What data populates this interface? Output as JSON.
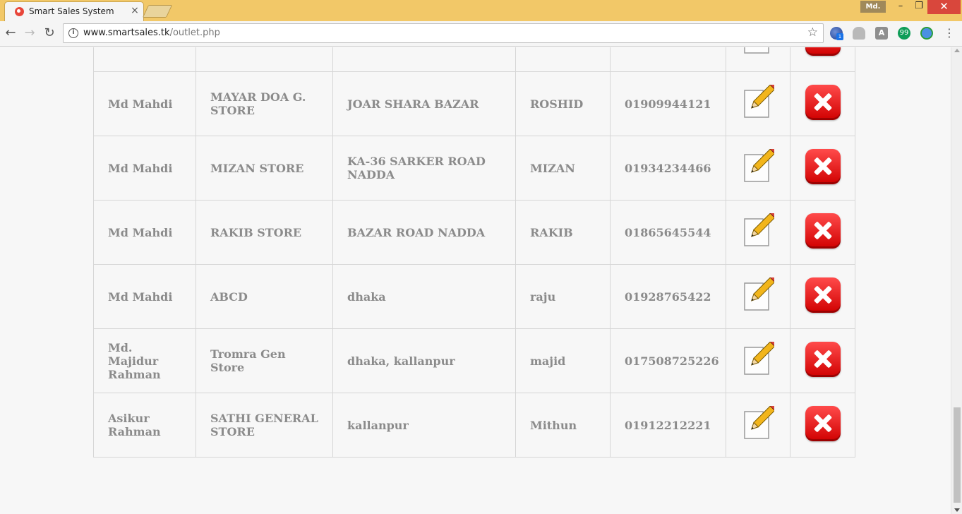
{
  "browser": {
    "tab_title": "Smart Sales System",
    "tab_close": "×",
    "profile": "Md.",
    "url_host": "www.smartsales.tk",
    "url_path": "/outlet.php",
    "window_min": "–",
    "window_max": "❐",
    "window_close": "✕",
    "back": "←",
    "forward": "→",
    "reload": "↻",
    "star": "☆",
    "menu": "⋮",
    "ext_badge": "1",
    "ext_letter": "A",
    "ext_hangouts": "99"
  },
  "table": {
    "rows": [
      {
        "name": "",
        "outlet": "",
        "address": "",
        "owner": "",
        "phone": ""
      },
      {
        "name": "Md Mahdi",
        "outlet": "MAYAR DOA G. STORE",
        "address": "JOAR SHARA BAZAR",
        "owner": "ROSHID",
        "phone": "01909944121"
      },
      {
        "name": "Md Mahdi",
        "outlet": "MIZAN STORE",
        "address": "KA-36 SARKER ROAD NADDA",
        "owner": "MIZAN",
        "phone": "01934234466"
      },
      {
        "name": "Md Mahdi",
        "outlet": "RAKIB STORE",
        "address": "BAZAR ROAD NADDA",
        "owner": "RAKIB",
        "phone": "01865645544"
      },
      {
        "name": "Md Mahdi",
        "outlet": "ABCD",
        "address": "dhaka",
        "owner": "raju",
        "phone": "01928765422"
      },
      {
        "name": "Md. Majidur Rahman",
        "outlet": "Tromra Gen Store",
        "address": "dhaka, kallanpur",
        "owner": "majid",
        "phone": "017508725226"
      },
      {
        "name": "Asikur Rahman",
        "outlet": "SATHI GENERAL STORE",
        "address": "kallanpur",
        "owner": "Mithun",
        "phone": "01912212221"
      }
    ],
    "edit_icon": "pencil-edit-icon",
    "delete_icon": "red-x-delete-icon"
  }
}
